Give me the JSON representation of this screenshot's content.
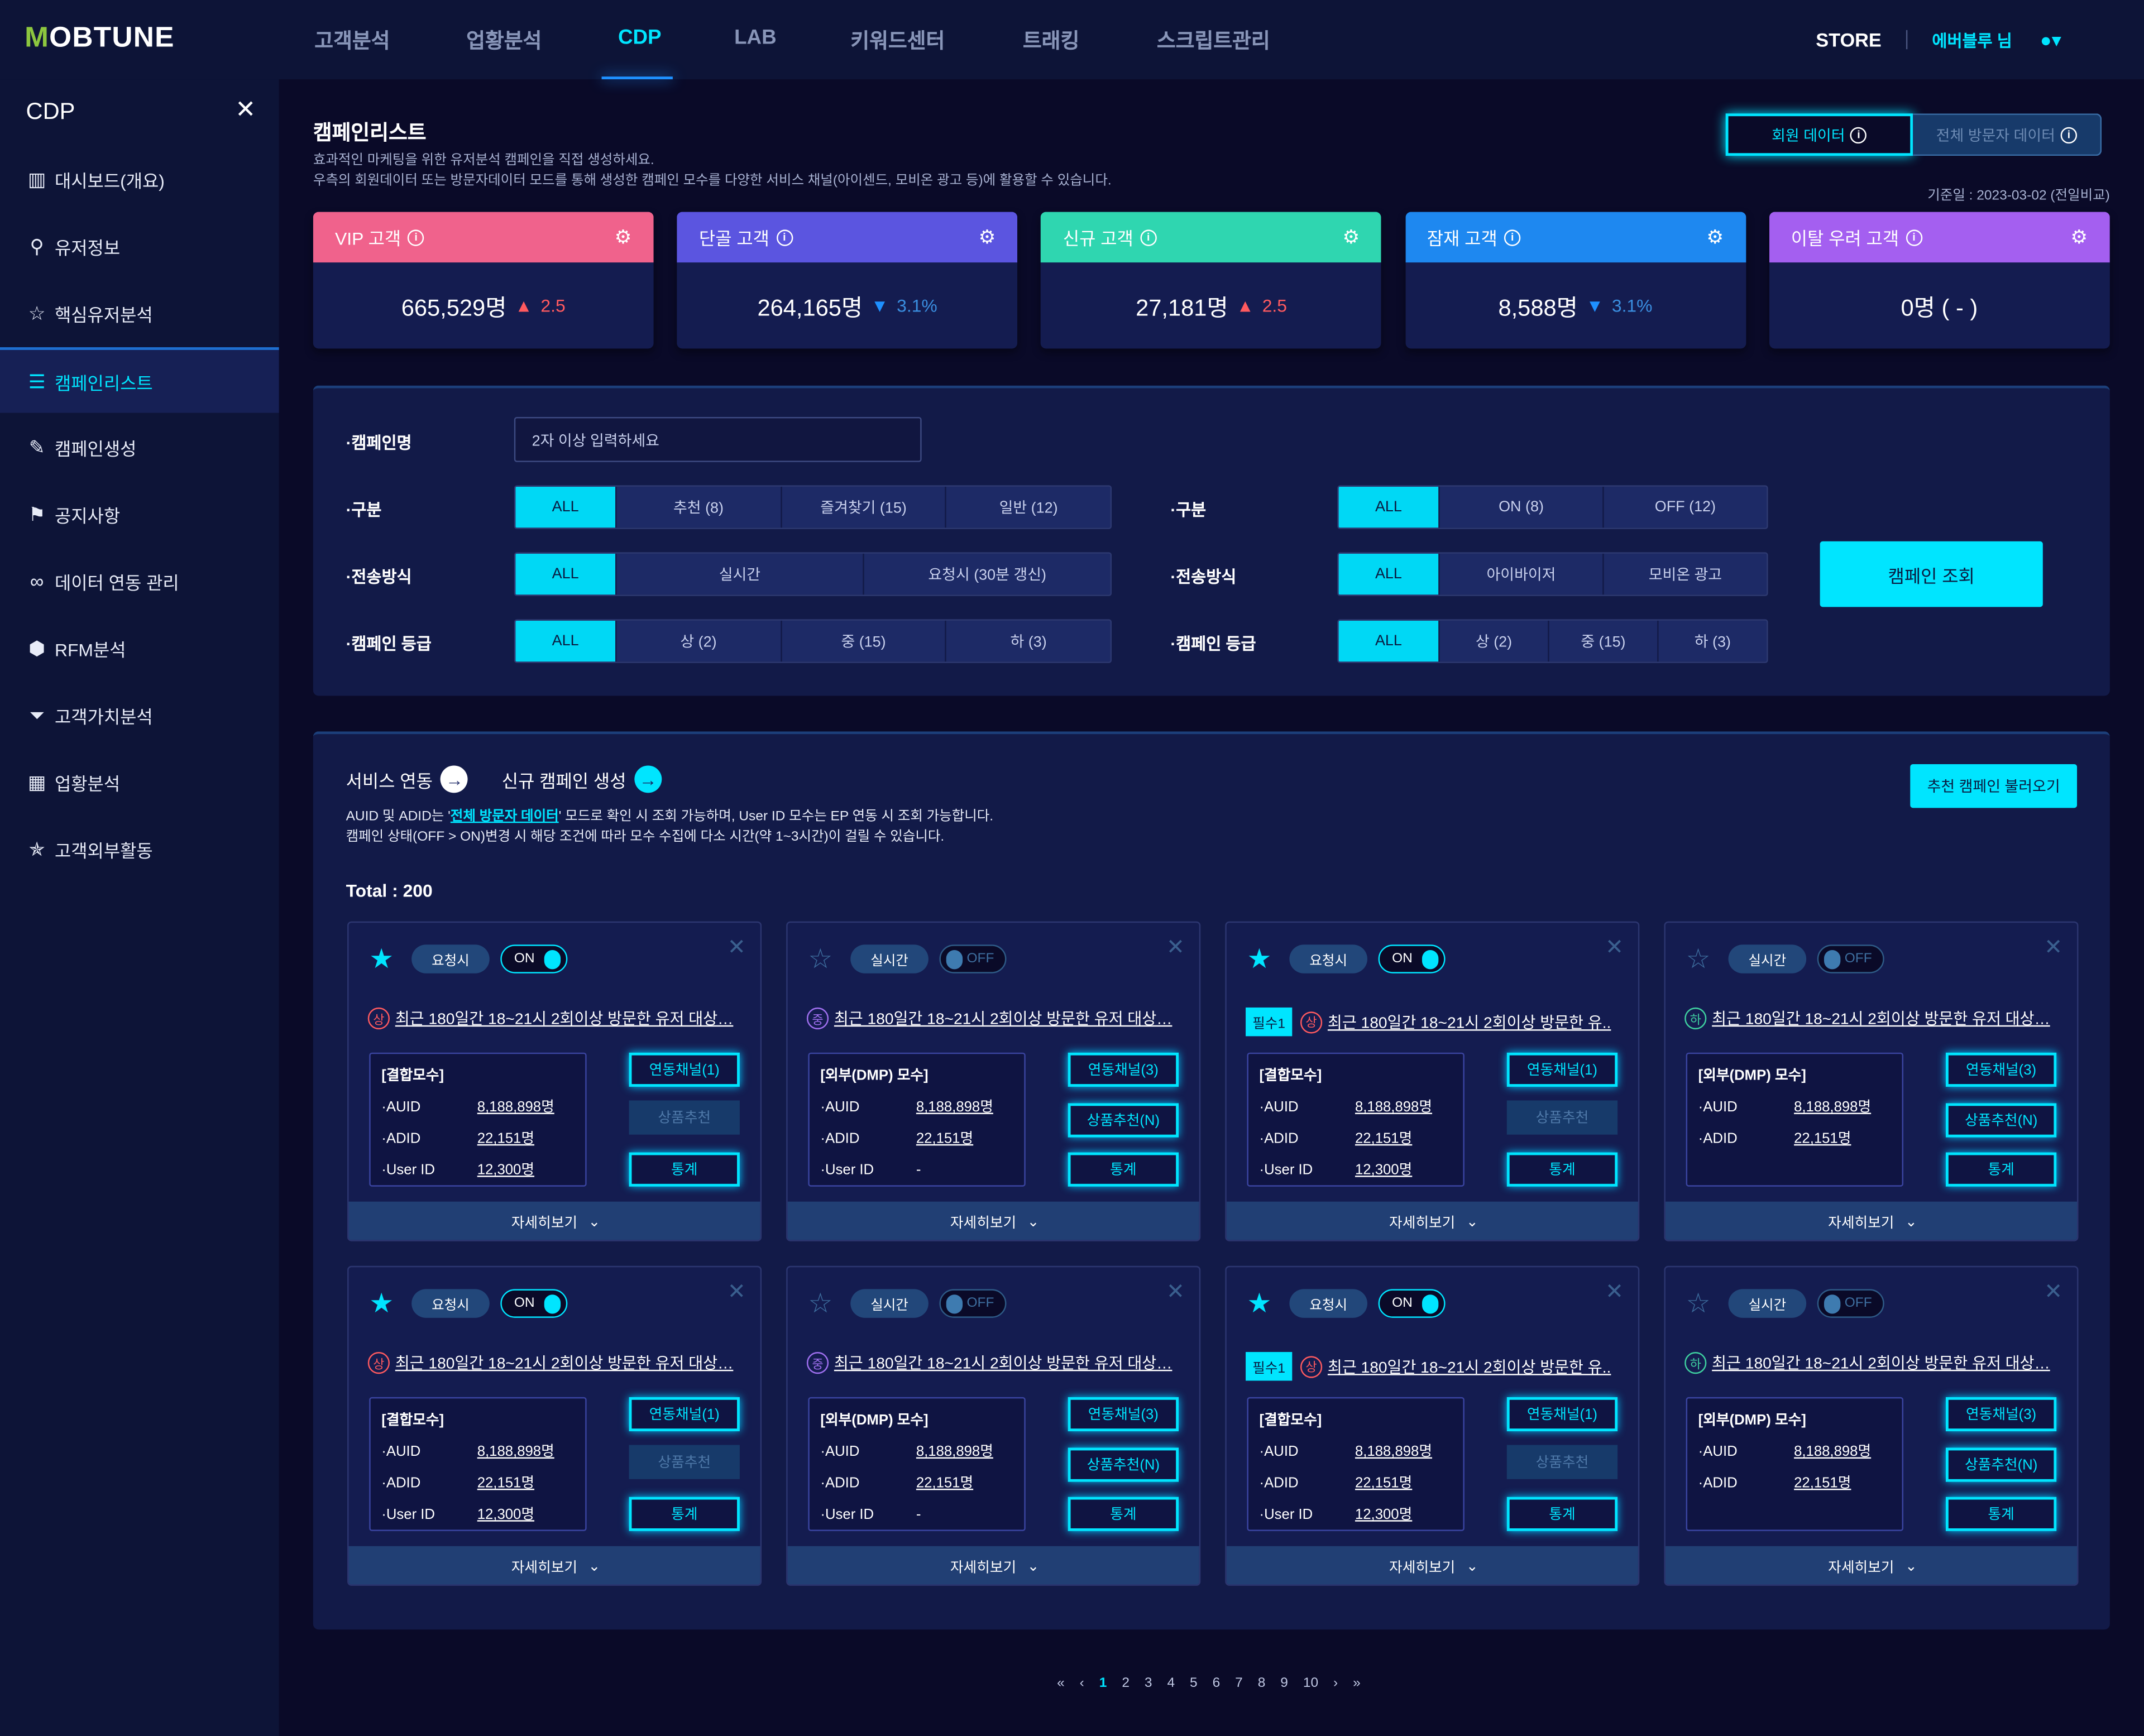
{
  "header": {
    "logo": "MOBTUNE",
    "nav": [
      "고객분석",
      "업황분석",
      "CDP",
      "LAB",
      "키워드센터",
      "트래킹",
      "스크립트관리"
    ],
    "active_nav": "CDP",
    "store": "STORE",
    "user": "에버블루 님"
  },
  "sidebar": {
    "title": "CDP",
    "items": [
      {
        "label": "대시보드(개요)",
        "icon": "chart-icon"
      },
      {
        "label": "유저정보",
        "icon": "user-info-icon"
      },
      {
        "label": "핵심유저분석",
        "icon": "user-star-icon"
      },
      {
        "label": "캠페인리스트",
        "icon": "list-icon",
        "active": true
      },
      {
        "label": "캠페인생성",
        "icon": "edit-icon"
      },
      {
        "label": "공지사항",
        "icon": "megaphone-icon"
      },
      {
        "label": "데이터 연동 관리",
        "icon": "link-icon"
      },
      {
        "label": "RFM분석",
        "icon": "cube-icon"
      },
      {
        "label": "고객가치분석",
        "icon": "filter-icon"
      },
      {
        "label": "업황분석",
        "icon": "grid-icon"
      },
      {
        "label": "고객외부활동",
        "icon": "star-network-icon"
      }
    ]
  },
  "page": {
    "title": "캠페인리스트",
    "desc1": "효과적인 마케팅을 위한 유저분석 캠페인을 직접 생성하세요.",
    "desc2": "우측의 회원데이터 또는 방문자데이터 모드를 통해 생성한 캠페인 모수를 다양한 서비스 채널(아이센드, 모비온 광고 등)에 활용할 수 있습니다.",
    "mode_member": "회원 데이터",
    "mode_all": "전체 방문자 데이터",
    "base_date": "기준일 : 2023-03-02 (전일비교)"
  },
  "kpis": [
    {
      "label": "VIP 고객",
      "value": "665,529명",
      "dir": "up",
      "change": "2.5",
      "color": "#f0628c"
    },
    {
      "label": "단골 고객",
      "value": "264,165명",
      "dir": "down",
      "change": "3.1%",
      "color": "#5b55e0"
    },
    {
      "label": "신규 고객",
      "value": "27,181명",
      "dir": "up",
      "change": "2.5",
      "color": "#2fd6b0"
    },
    {
      "label": "잠재 고객",
      "value": "8,588명",
      "dir": "down",
      "change": "3.1%",
      "color": "#1e88f0"
    },
    {
      "label": "이탈 우려 고객",
      "value": "0명 ( - )",
      "dir": "",
      "change": "",
      "color": "#a45ff0"
    }
  ],
  "filters": {
    "name_label": "·캠페인명",
    "name_placeholder": "2자 이상 입력하세요",
    "left": [
      {
        "label": "·구분",
        "options": [
          "ALL",
          "추천 (8)",
          "즐겨찾기 (15)",
          "일반 (12)"
        ]
      },
      {
        "label": "·전송방식",
        "options": [
          "ALL",
          "실시간",
          "요청시 (30분 갱신)"
        ]
      },
      {
        "label": "·캠페인 등급",
        "options": [
          "ALL",
          "상 (2)",
          "중 (15)",
          "하 (3)"
        ]
      }
    ],
    "right": [
      {
        "label": "·구분",
        "options": [
          "ALL",
          "ON (8)",
          "OFF (12)"
        ]
      },
      {
        "label": "·전송방식",
        "options": [
          "ALL",
          "아이바이저",
          "모비온 광고"
        ]
      },
      {
        "label": "·캠페인 등급",
        "options": [
          "ALL",
          "상 (2)",
          "중 (15)",
          "하 (3)"
        ]
      }
    ],
    "search": "캠페인 조회"
  },
  "list": {
    "service_link": "서비스 연동",
    "new_link": "신규 캠페인 생성",
    "note1_pre": "AUID 및 ADID는 '",
    "note1_hl": "전체 방문자 데이터",
    "note1_post": "' 모드로 확인 시 조회 가능하며, User ID 모수는 EP 연동 시 조회 가능합니다.",
    "note2": "캠페인 상태(OFF > ON)변경 시 해당 조건에 따라 모수 수집에 다소 시간(약 1~3시간)이 걸릴 수 있습니다.",
    "recommend": "추천 캠페인 불러오기",
    "total": "Total : 200",
    "more": "자세히보기",
    "cards": [
      {
        "fav": true,
        "mode": "요청시",
        "on": true,
        "req": "",
        "grade": "상",
        "title": "최근 180일간 18~21시 2회이상 방문한 유저 대상…",
        "box": "[결합모수]",
        "auid": "8,188,898명",
        "adid": "22,151명",
        "userid": "12,300명",
        "ch": "연동채널(1)",
        "rec": "상품추천",
        "rec_on": false
      },
      {
        "fav": false,
        "mode": "실시간",
        "on": false,
        "req": "",
        "grade": "중",
        "title": "최근 180일간 18~21시 2회이상 방문한 유저 대상…",
        "box": "[외부(DMP) 모수]",
        "auid": "8,188,898명",
        "adid": "22,151명",
        "userid": "-",
        "ch": "연동채널(3)",
        "rec": "상품추천(N)",
        "rec_on": true
      },
      {
        "fav": true,
        "mode": "요청시",
        "on": true,
        "req": "필수1",
        "grade": "상",
        "title": "최근 180일간 18~21시 2회이상 방문한 유..",
        "box": "[결합모수]",
        "auid": "8,188,898명",
        "adid": "22,151명",
        "userid": "12,300명",
        "ch": "연동채널(1)",
        "rec": "상품추천",
        "rec_on": false
      },
      {
        "fav": false,
        "mode": "실시간",
        "on": false,
        "req": "",
        "grade": "하",
        "title": "최근 180일간 18~21시 2회이상 방문한 유저 대상…",
        "box": "[외부(DMP) 모수]",
        "auid": "8,188,898명",
        "adid": "22,151명",
        "userid": null,
        "ch": "연동채널(3)",
        "rec": "상품추천(N)",
        "rec_on": true
      },
      {
        "fav": true,
        "mode": "요청시",
        "on": true,
        "req": "",
        "grade": "상",
        "title": "최근 180일간 18~21시 2회이상 방문한 유저 대상…",
        "box": "[결합모수]",
        "auid": "8,188,898명",
        "adid": "22,151명",
        "userid": "12,300명",
        "ch": "연동채널(1)",
        "rec": "상품추천",
        "rec_on": false
      },
      {
        "fav": false,
        "mode": "실시간",
        "on": false,
        "req": "",
        "grade": "중",
        "title": "최근 180일간 18~21시 2회이상 방문한 유저 대상…",
        "box": "[외부(DMP) 모수]",
        "auid": "8,188,898명",
        "adid": "22,151명",
        "userid": "-",
        "ch": "연동채널(3)",
        "rec": "상품추천(N)",
        "rec_on": true
      },
      {
        "fav": true,
        "mode": "요청시",
        "on": true,
        "req": "필수1",
        "grade": "상",
        "title": "최근 180일간 18~21시 2회이상 방문한 유..",
        "box": "[결합모수]",
        "auid": "8,188,898명",
        "adid": "22,151명",
        "userid": "12,300명",
        "ch": "연동채널(1)",
        "rec": "상품추천",
        "rec_on": false
      },
      {
        "fav": false,
        "mode": "실시간",
        "on": false,
        "req": "",
        "grade": "하",
        "title": "최근 180일간 18~21시 2회이상 방문한 유저 대상…",
        "box": "[외부(DMP) 모수]",
        "auid": "8,188,898명",
        "adid": "22,151명",
        "userid": null,
        "ch": "연동채널(3)",
        "rec": "상품추천(N)",
        "rec_on": true
      }
    ],
    "stats": "통계",
    "on_label": "ON",
    "off_label": "OFF",
    "auid_label": "·AUID",
    "adid_label": "·ADID",
    "userid_label": "·User ID"
  },
  "pagination": {
    "pages": [
      "1",
      "2",
      "3",
      "4",
      "5",
      "6",
      "7",
      "8",
      "9",
      "10"
    ],
    "current": "1"
  },
  "colors": {
    "accent": "#00e5ff",
    "grade_high": "#ff5a5f",
    "grade_mid": "#a070f0",
    "grade_low": "#3fd0a0"
  }
}
